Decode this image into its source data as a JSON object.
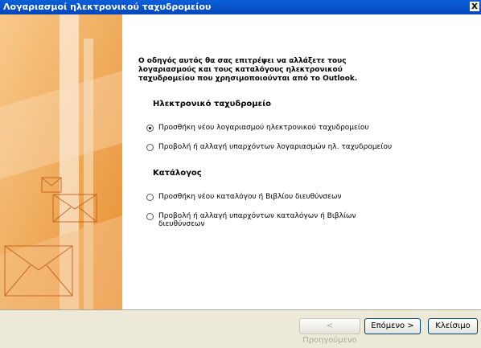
{
  "window": {
    "title": "Λογαριασμοί ηλεκτρονικού ταχυδρομείου",
    "close_label": "X"
  },
  "intro": "Ο οδηγός αυτός θα σας επιτρέψει να αλλάξετε τους λογαριασμούς και τους καταλόγους ηλεκτρονικού ταχυδρομείου που χρησιμοποιούνται από το Outlook.",
  "email_section": {
    "title": "Ηλεκτρονικό ταχυδρομείο",
    "options": [
      {
        "label": "Προσθήκη νέου λογαριασμού ηλεκτρονικού ταχυδρομείου",
        "selected": true
      },
      {
        "label": "Προβολή ή αλλαγή υπαρχόντων λογαριασμών ηλ. ταχυδρομείου",
        "selected": false
      }
    ]
  },
  "directory_section": {
    "title": "Κατάλογος",
    "options": [
      {
        "label": "Προσθήκη νέου καταλόγου ή Βιβλίου διευθύνσεων",
        "selected": false
      },
      {
        "label": "Προβολή ή αλλαγή υπαρχόντων καταλόγων ή Βιβλίων διευθύνσεων",
        "selected": false
      }
    ]
  },
  "buttons": {
    "back": "< Προηγούμενο",
    "next": "Επόμενο >",
    "close": "Κλείσιμο"
  },
  "colors": {
    "titlebar": "#0a5fd8",
    "art_orange": "#f2b267"
  },
  "icons": {
    "art": "envelope-illustration"
  }
}
